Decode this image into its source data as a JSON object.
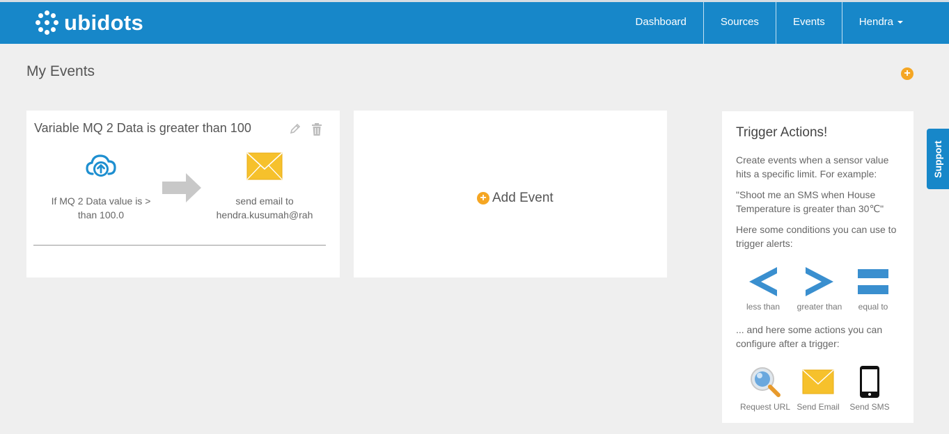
{
  "brand": {
    "name": "ubidots"
  },
  "nav": {
    "dashboard": "Dashboard",
    "sources": "Sources",
    "events": "Events",
    "user": "Hendra"
  },
  "page": {
    "title": "My Events"
  },
  "event_card": {
    "title": "Variable MQ 2 Data is greater than 100",
    "trigger_text_1": "If MQ 2 Data value is >",
    "trigger_text_2": "than 100.0",
    "action_text_1": "send email to",
    "action_text_2": "hendra.kusumah@rah"
  },
  "add_event": {
    "label": "Add Event"
  },
  "side_panel": {
    "title": "Trigger Actions!",
    "p1": "Create events when a sensor value hits a specific limit. For example:",
    "p2": "\"Shoot me an SMS when House Temperature is greater than 30℃\"",
    "p3": "Here some conditions you can use to trigger alerts:",
    "conditions": [
      "less than",
      "greater than",
      "equal to"
    ],
    "p4": "... and here some actions you can configure after a trigger:",
    "actions": [
      "Request URL",
      "Send Email",
      "Send SMS"
    ]
  },
  "support": {
    "label": "Support"
  },
  "colors": {
    "primary": "#1787c9",
    "accent": "#f5a623",
    "condition_blue": "#3a8fcf"
  }
}
